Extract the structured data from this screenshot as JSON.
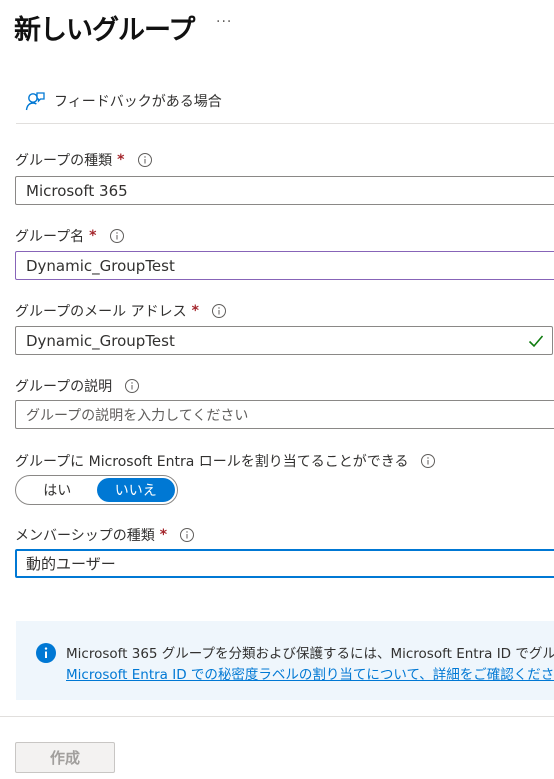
{
  "page": {
    "title": "新しいグループ",
    "more_label": "···",
    "feedback_label": "フィードバックがある場合"
  },
  "form": {
    "group_type": {
      "label": "グループの種類",
      "required": "*",
      "value": "Microsoft 365"
    },
    "group_name": {
      "label": "グループ名",
      "required": "*",
      "value": "Dynamic_GroupTest"
    },
    "group_email": {
      "label": "グループのメール アドレス",
      "required": "*",
      "value": "Dynamic_GroupTest"
    },
    "group_description": {
      "label": "グループの説明",
      "placeholder": "グループの説明を入力してください",
      "value": ""
    },
    "entra_roles": {
      "label": "グループに Microsoft Entra ロールを割り当てることができる",
      "yes": "はい",
      "no": "いいえ",
      "selected": "いいえ"
    },
    "membership_type": {
      "label": "メンバーシップの種類",
      "required": "*",
      "value": "動的ユーザー"
    }
  },
  "info_banner": {
    "text": "Microsoft 365 グループを分類および保護するには、Microsoft Entra ID でグル",
    "link": "Microsoft Entra ID での秘密度ラベルの割り当てについて、詳細をご確認くださ"
  },
  "footer": {
    "create_label": "作成"
  },
  "colors": {
    "accent": "#0078d4",
    "required": "#a4262c",
    "valid": "#107c10",
    "name_border": "#8764b8"
  },
  "icons": {
    "feedback": "feedback-person-icon",
    "info": "info-circle-icon",
    "check": "checkmark-icon"
  }
}
